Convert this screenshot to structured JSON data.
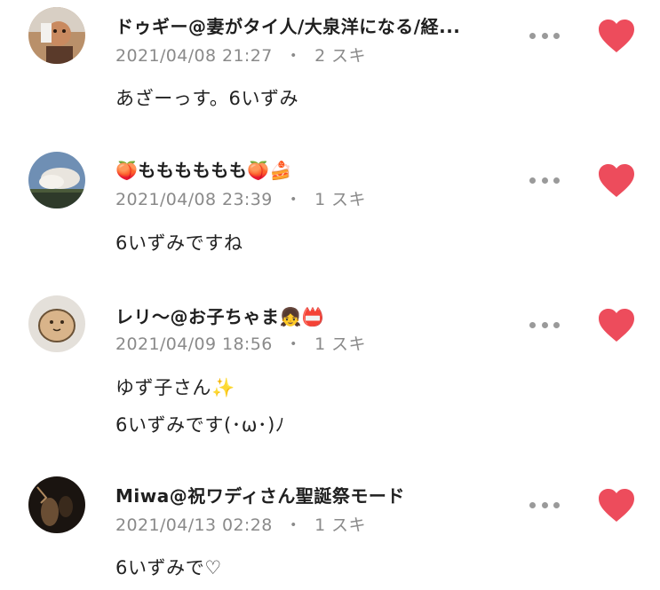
{
  "colors": {
    "heart": "#ed4c5c",
    "meta_text": "#8a8a8a",
    "dots": "#9a9a9a"
  },
  "comments": [
    {
      "name": "ドゥギー@妻がタイ人/大泉洋になる/経...",
      "date": "2021/04/08 21:27",
      "separator": "・",
      "likes": "2 スキ",
      "lines": [
        "あざーっす。6いずみ"
      ],
      "liked": true
    },
    {
      "name_prefix_emoji": "🍑",
      "name": "もももももも",
      "name_suffix_emoji": "🍑🍰",
      "date": "2021/04/08 23:39",
      "separator": "・",
      "likes": "1 スキ",
      "lines": [
        "6いずみですね"
      ],
      "liked": true
    },
    {
      "name": "レリ〜@お子ちゃま",
      "name_suffix_emoji": "👧📛",
      "date": "2021/04/09 18:56",
      "separator": "・",
      "likes": "1 スキ",
      "lines": [
        "ゆず子さん",
        "6いずみです(･ω･)ﾉ"
      ],
      "line_emoji": "✨",
      "liked": true
    },
    {
      "name": "Miwa@祝ワディさん聖誕祭モード",
      "date": "2021/04/13 02:28",
      "separator": "・",
      "likes": "1 スキ",
      "lines": [
        "6いずみで♡"
      ],
      "liked": true
    }
  ]
}
